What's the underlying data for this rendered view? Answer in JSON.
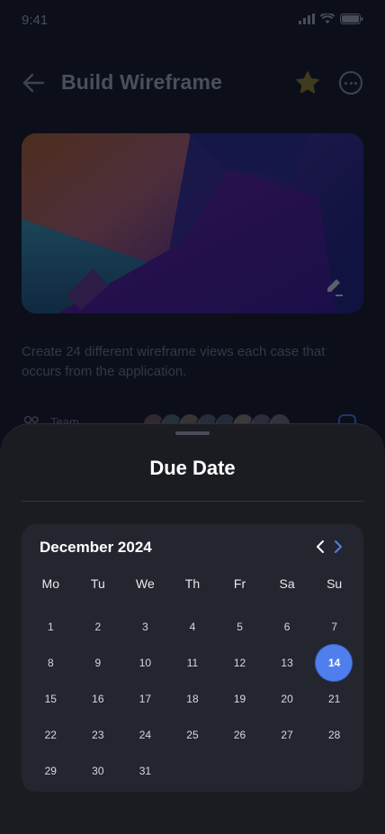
{
  "status": {
    "time": "9:41"
  },
  "header": {
    "title": "Build Wireframe"
  },
  "task": {
    "description": "Create 24 different wireframe views each case that occurs from the application.",
    "team_label": "Team"
  },
  "sheet": {
    "title": "Due Date"
  },
  "calendar": {
    "month_label": "December 2024",
    "weekdays": [
      "Mo",
      "Tu",
      "We",
      "Th",
      "Fr",
      "Sa",
      "Su"
    ],
    "days": [
      "1",
      "2",
      "3",
      "4",
      "5",
      "6",
      "7",
      "8",
      "9",
      "10",
      "11",
      "12",
      "13",
      "14",
      "15",
      "16",
      "17",
      "18",
      "19",
      "20",
      "21",
      "22",
      "23",
      "24",
      "25",
      "26",
      "27",
      "28",
      "29",
      "30",
      "31"
    ],
    "selected_day": "14",
    "accent_color": "#4f7fec"
  },
  "avatar_colors": [
    "#6b5a52",
    "#4c6b73",
    "#7d7266",
    "#58606a",
    "#4e5a6a",
    "#8a7f78",
    "#5a5f72",
    "#6a6e7c"
  ]
}
